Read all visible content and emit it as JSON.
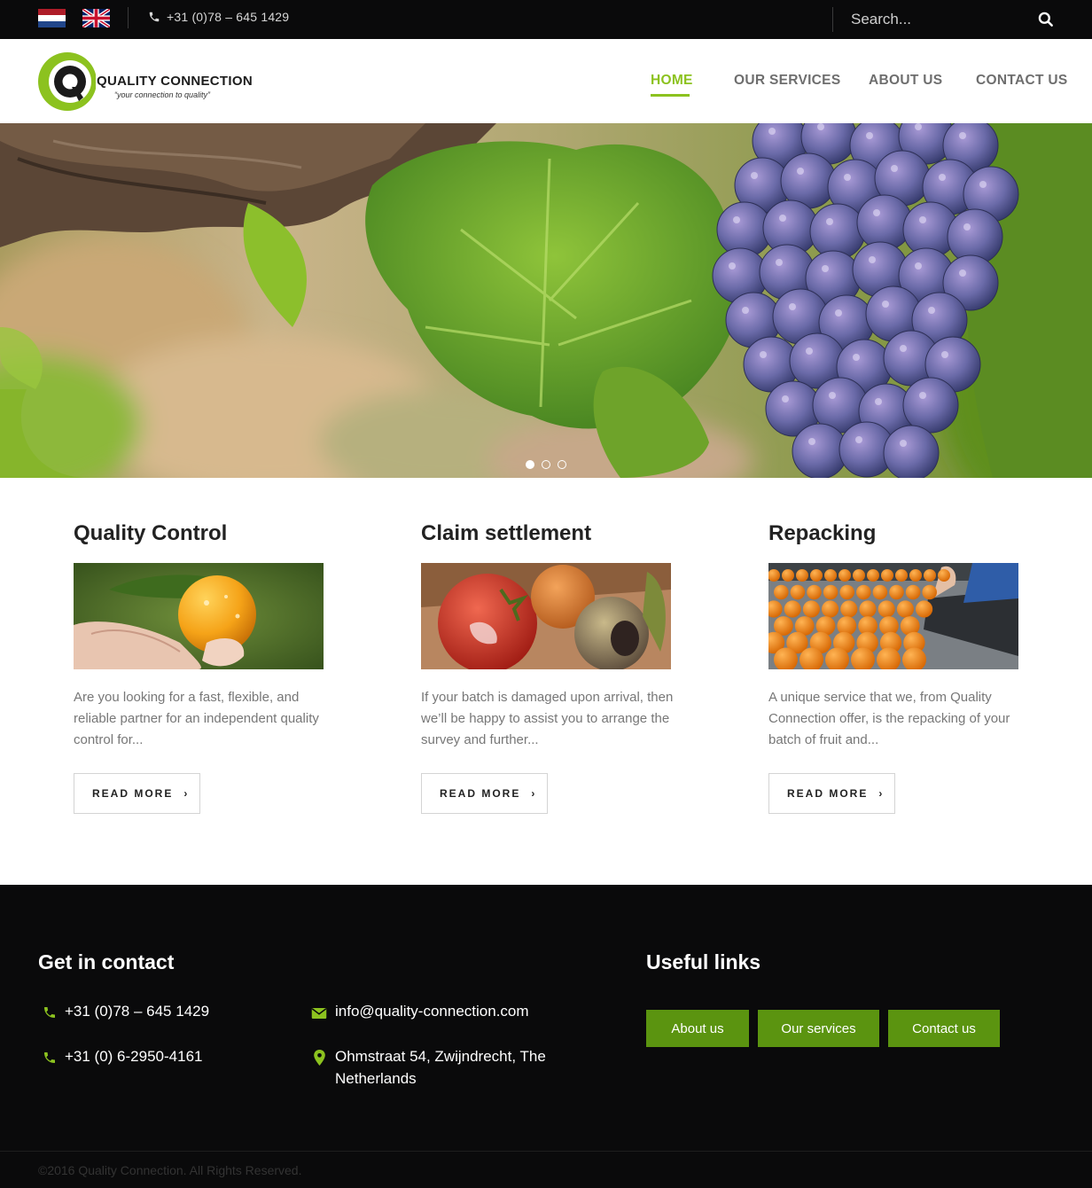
{
  "topbar": {
    "languages": [
      "Nederlands",
      "English"
    ],
    "phone": "+31 (0)78 – 645 1429",
    "search_placeholder": "Search..."
  },
  "header": {
    "logo_name": "QUALITY CONNECTION",
    "logo_tagline": "“your connection to quality”",
    "nav": [
      "HOME",
      "OUR SERVICES",
      "ABOUT US",
      "CONTACT US"
    ],
    "active_nav": "HOME"
  },
  "hero": {
    "slide_count": 3,
    "active_slide": 1
  },
  "services": [
    {
      "title": "Quality Control",
      "text": "Are you looking for a fast, flexible, and reliable partner for an independent quality control for...",
      "button": "READ MORE"
    },
    {
      "title": "Claim settlement",
      "text": "If your batch is damaged upon arrival, then we’ll be happy to assist you to arrange the survey and further...",
      "button": "READ MORE"
    },
    {
      "title": "Repacking",
      "text": "A unique service that we, from Quality Connection offer, is the repacking of your batch of fruit and...",
      "button": "READ MORE"
    }
  ],
  "footer": {
    "contact_heading": "Get in contact",
    "phone_1": "+31 (0)78 – 645 1429",
    "phone_2": "+31 (0) 6-2950-4161",
    "email": "info@quality-connection.com",
    "address_line_1": "Ohmstraat 54, Zwijndrecht, The",
    "address_line_2": "Netherlands",
    "links_heading": "Useful links",
    "links": [
      "About us",
      "Our services",
      "Contact us"
    ],
    "copyright": "©2016 Quality Connection. All Rights Reserved."
  },
  "colors": {
    "accent": "#8cc21f",
    "link_button": "#5b9410",
    "topbar": "#0a0a0b",
    "footer": "#0a0a0b"
  },
  "icons": [
    "phone-icon",
    "search-icon",
    "email-icon",
    "map-pin-icon",
    "chevron-right-icon"
  ]
}
